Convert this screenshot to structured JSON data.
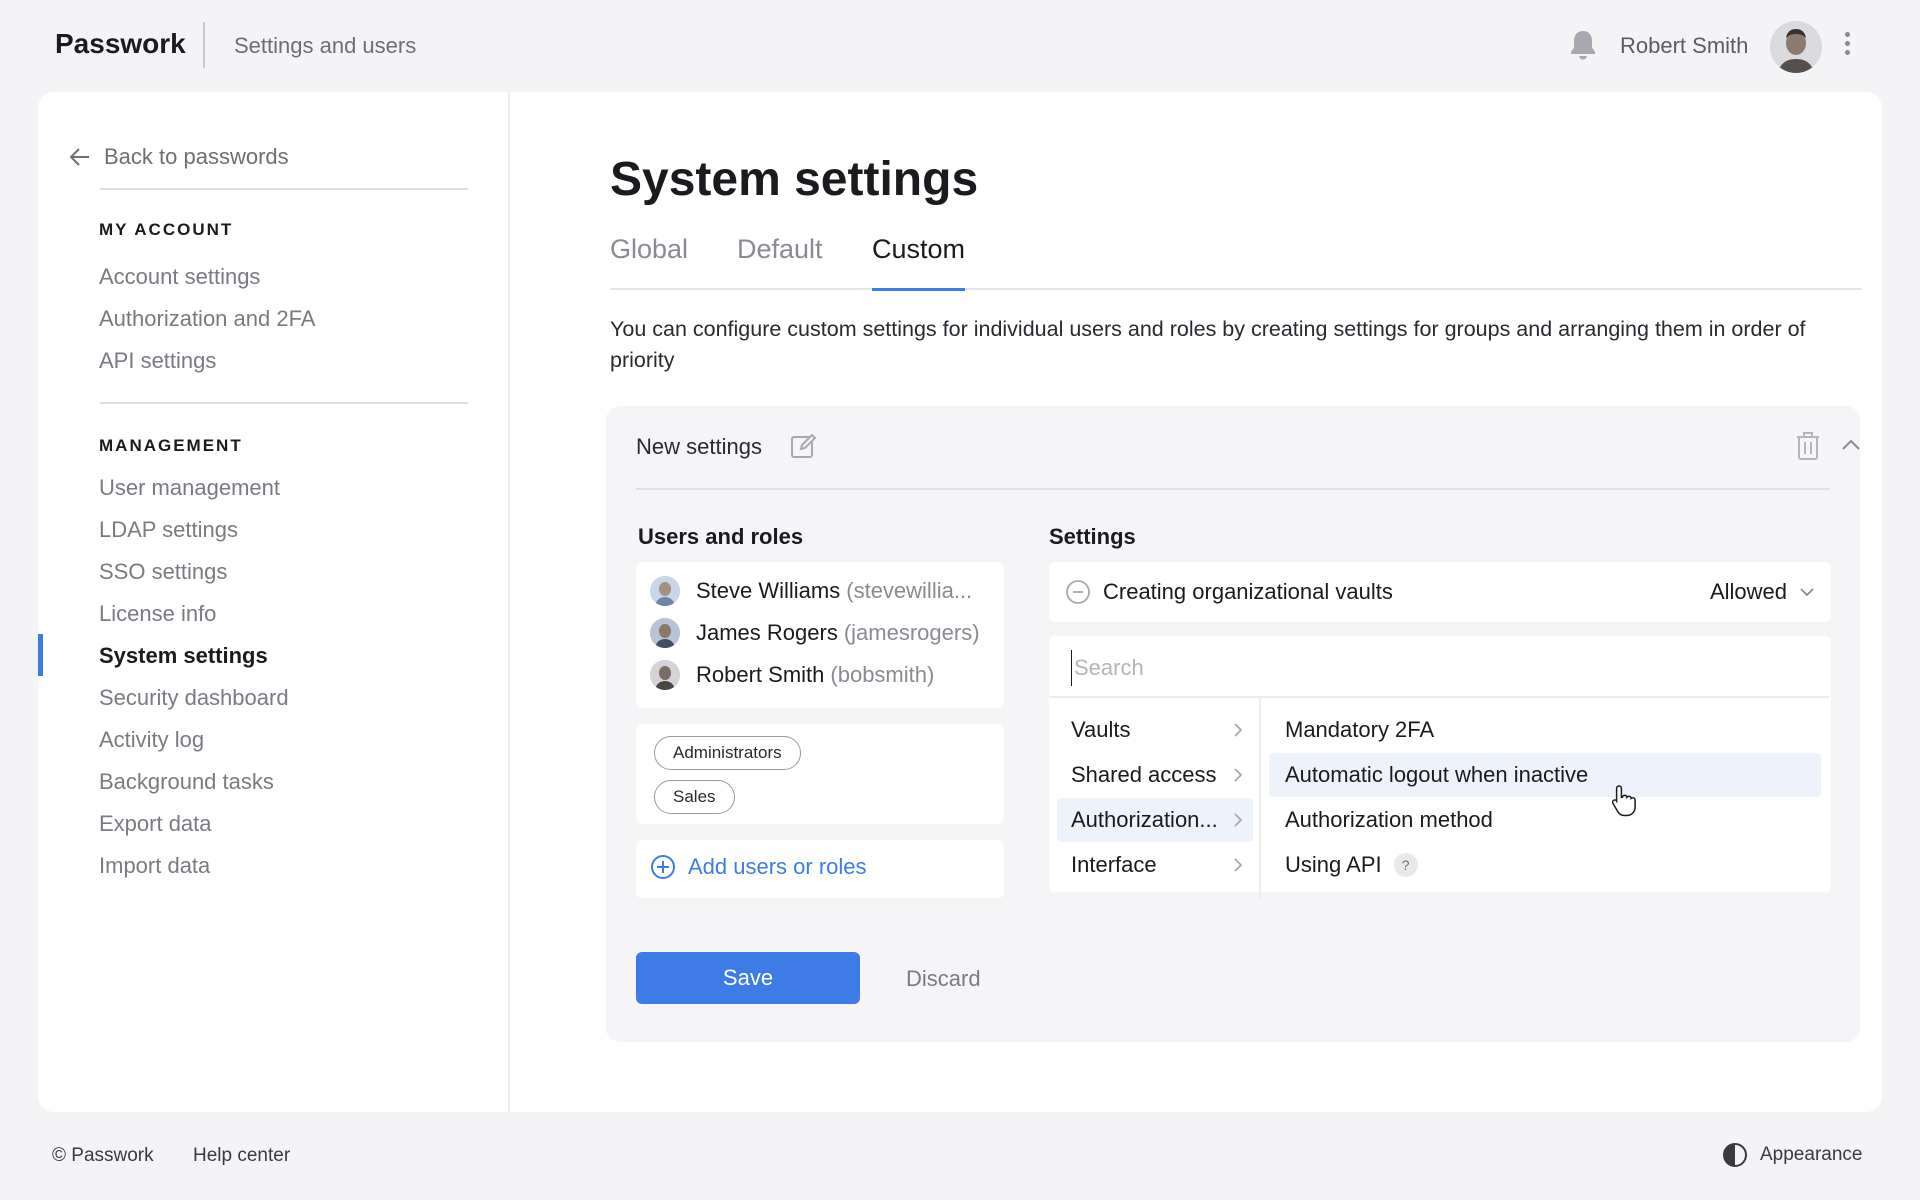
{
  "header": {
    "logo": "Passwork",
    "section": "Settings and users",
    "user_name": "Robert Smith"
  },
  "sidebar": {
    "back_label": "Back to passwords",
    "my_account_heading": "MY ACCOUNT",
    "my_account_items": [
      "Account settings",
      "Authorization and 2FA",
      "API settings"
    ],
    "management_heading": "MANAGEMENT",
    "management_items": [
      "User management",
      "LDAP settings",
      "SSO settings",
      "License info",
      "System settings",
      "Security dashboard",
      "Activity log",
      "Background tasks",
      "Export data",
      "Import data"
    ],
    "active_item": "System settings"
  },
  "main": {
    "title": "System settings",
    "tabs": [
      "Global",
      "Default",
      "Custom"
    ],
    "active_tab": "Custom",
    "description": "You can configure custom settings for individual users and roles by creating settings for groups and arranging them in order of priority"
  },
  "panel": {
    "title": "New settings",
    "users_heading": "Users and roles",
    "settings_heading": "Settings",
    "users": [
      {
        "name": "Steve Williams",
        "login": "(stevewillia..."
      },
      {
        "name": "James Rogers",
        "login": "(jamesrogers)"
      },
      {
        "name": "Robert Smith",
        "login": "(bobsmith)"
      }
    ],
    "roles": [
      "Administrators",
      "Sales"
    ],
    "add_label": "Add users or roles",
    "setting_row": {
      "label": "Creating organizational vaults",
      "value": "Allowed"
    },
    "search_placeholder": "Search",
    "categories": [
      "Vaults",
      "Shared access",
      "Authorization...",
      "Interface"
    ],
    "active_category": "Authorization...",
    "options": [
      "Mandatory 2FA",
      "Automatic logout when inactive",
      "Authorization method",
      "Using API"
    ],
    "hovered_option": "Automatic logout when inactive",
    "help_mark": "?",
    "save_label": "Save",
    "discard_label": "Discard"
  },
  "footer": {
    "copyright": "© Passwork",
    "help": "Help center",
    "appearance": "Appearance"
  },
  "colors": {
    "accent": "#3d7be6",
    "background": "#f4f4f6",
    "panel": "#f5f5f7",
    "hover": "#eef2fb"
  }
}
